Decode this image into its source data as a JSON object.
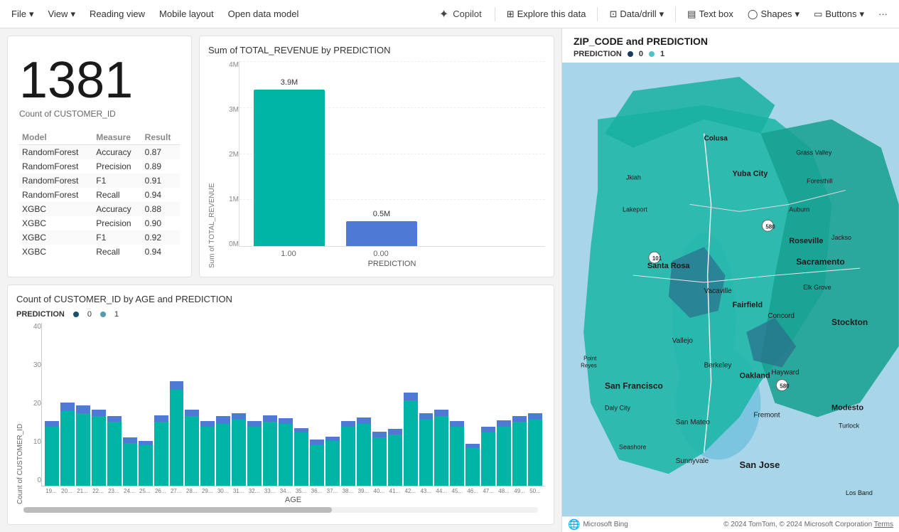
{
  "toolbar": {
    "file_label": "File",
    "view_label": "View",
    "reading_view_label": "Reading view",
    "mobile_layout_label": "Mobile layout",
    "open_data_model_label": "Open data model",
    "copilot_label": "Copilot",
    "explore_label": "Explore this data",
    "data_drill_label": "Data/drill",
    "text_box_label": "Text box",
    "shapes_label": "Shapes",
    "buttons_label": "Buttons"
  },
  "number_card": {
    "value": "1381",
    "label": "Count of CUSTOMER_ID"
  },
  "metrics_table": {
    "headers": [
      "Model",
      "Measure",
      "Result"
    ],
    "rows": [
      [
        "RandomForest",
        "Accuracy",
        "0.87"
      ],
      [
        "RandomForest",
        "Precision",
        "0.89"
      ],
      [
        "RandomForest",
        "F1",
        "0.91"
      ],
      [
        "RandomForest",
        "Recall",
        "0.94"
      ],
      [
        "XGBC",
        "Accuracy",
        "0.88"
      ],
      [
        "XGBC",
        "Precision",
        "0.90"
      ],
      [
        "XGBC",
        "F1",
        "0.92"
      ],
      [
        "XGBC",
        "Recall",
        "0.94"
      ]
    ]
  },
  "bar_chart": {
    "title": "Sum of TOTAL_REVENUE by PREDICTION",
    "y_labels": [
      "4M",
      "3M",
      "2M",
      "1M",
      "0M"
    ],
    "bars": [
      {
        "label": "1.00",
        "value_text": "3.9M",
        "height_pct": 90,
        "color": "teal"
      },
      {
        "label": "0.00",
        "value_text": "0.5M",
        "height_pct": 15,
        "color": "blue"
      }
    ],
    "x_axis_label": "PREDICTION",
    "y_axis_label": "Sum of TOTAL_REVENUE"
  },
  "age_chart": {
    "title": "Count of CUSTOMER_ID by AGE and PREDICTION",
    "legend_label": "PREDICTION",
    "legend_0": "0",
    "legend_1": "1",
    "y_labels": [
      "40",
      "30",
      "20",
      "10",
      "0"
    ],
    "x_axis_label": "AGE",
    "y_axis_label": "Count of CUSTOMER_ID",
    "bars": [
      {
        "age": "19...",
        "teal": 55,
        "blue": 5
      },
      {
        "age": "20...",
        "teal": 70,
        "blue": 8
      },
      {
        "age": "21...",
        "teal": 68,
        "blue": 7
      },
      {
        "age": "22...",
        "teal": 65,
        "blue": 6
      },
      {
        "age": "23...",
        "teal": 60,
        "blue": 5
      },
      {
        "age": "24...",
        "teal": 40,
        "blue": 5
      },
      {
        "age": "25...",
        "teal": 38,
        "blue": 4
      },
      {
        "age": "26...",
        "teal": 60,
        "blue": 6
      },
      {
        "age": "27...",
        "teal": 90,
        "blue": 8
      },
      {
        "age": "28...",
        "teal": 65,
        "blue": 6
      },
      {
        "age": "29...",
        "teal": 55,
        "blue": 5
      },
      {
        "age": "30...",
        "teal": 58,
        "blue": 7
      },
      {
        "age": "31...",
        "teal": 62,
        "blue": 6
      },
      {
        "age": "32...",
        "teal": 55,
        "blue": 5
      },
      {
        "age": "33...",
        "teal": 60,
        "blue": 6
      },
      {
        "age": "34...",
        "teal": 58,
        "blue": 5
      },
      {
        "age": "35...",
        "teal": 50,
        "blue": 4
      },
      {
        "age": "36...",
        "teal": 38,
        "blue": 5
      },
      {
        "age": "37...",
        "teal": 42,
        "blue": 4
      },
      {
        "age": "38...",
        "teal": 55,
        "blue": 5
      },
      {
        "age": "39...",
        "teal": 58,
        "blue": 6
      },
      {
        "age": "40...",
        "teal": 45,
        "blue": 5
      },
      {
        "age": "41...",
        "teal": 48,
        "blue": 5
      },
      {
        "age": "42...",
        "teal": 80,
        "blue": 7
      },
      {
        "age": "43...",
        "teal": 62,
        "blue": 6
      },
      {
        "age": "44...",
        "teal": 65,
        "blue": 6
      },
      {
        "age": "45...",
        "teal": 55,
        "blue": 5
      },
      {
        "age": "46...",
        "teal": 35,
        "blue": 4
      },
      {
        "age": "47...",
        "teal": 50,
        "blue": 5
      },
      {
        "age": "48...",
        "teal": 55,
        "blue": 6
      },
      {
        "age": "49...",
        "teal": 60,
        "blue": 5
      },
      {
        "age": "50...",
        "teal": 62,
        "blue": 6
      }
    ]
  },
  "map": {
    "title": "ZIP_CODE and PREDICTION",
    "legend_label": "PREDICTION",
    "legend_0": "0",
    "legend_1": "1",
    "credits": "© 2024 TomTom, © 2024 Microsoft Corporation",
    "terms_label": "Terms"
  }
}
